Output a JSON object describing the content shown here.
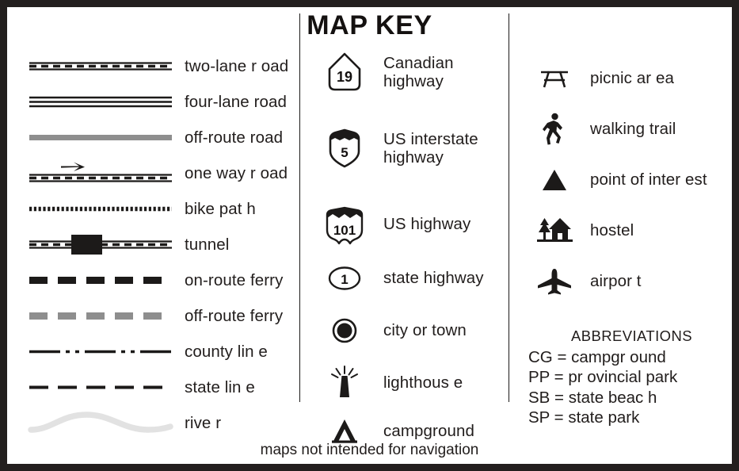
{
  "title": "MAP KEY",
  "footer": "maps not intended for navigation",
  "colors": {
    "ink": "#1c1a19",
    "frame": "#231f1e",
    "gray": "#8e8e8e",
    "river": "#e2e2e2",
    "paper": "#ffffff"
  },
  "columns": {
    "roads": {
      "name": "road-symbols",
      "items": [
        {
          "icon": "two-lane-road-symbol",
          "label": "two-lane r oad"
        },
        {
          "icon": "four-lane-road-symbol",
          "label": "four-lane road"
        },
        {
          "icon": "off-route-road-symbol",
          "label": "off-route road"
        },
        {
          "icon": "one-way-road-symbol",
          "label": "one way r oad"
        },
        {
          "icon": "bike-path-symbol",
          "label": "bike pat h"
        },
        {
          "icon": "tunnel-symbol",
          "label": "tunnel"
        },
        {
          "icon": "on-route-ferry-symbol",
          "label": "on-route ferry"
        },
        {
          "icon": "off-route-ferry-symbol",
          "label": "off-route ferry"
        },
        {
          "icon": "county-line-symbol",
          "label": "county lin e"
        },
        {
          "icon": "state-line-symbol",
          "label": "state lin e"
        },
        {
          "icon": "river-symbol",
          "label": "rive r"
        }
      ]
    },
    "routes": {
      "name": "route-marker-symbols",
      "items": [
        {
          "icon": "canadian-highway-shield-icon",
          "number": "19",
          "label": "Canadian\nhighway"
        },
        {
          "icon": "us-interstate-shield-icon",
          "number": "5",
          "label": "US interstate\nhighway"
        },
        {
          "icon": "us-highway-shield-icon",
          "number": "101",
          "label": "US highway"
        },
        {
          "icon": "state-highway-oval-icon",
          "number": "1",
          "label": "state highway"
        },
        {
          "icon": "city-or-town-icon",
          "number": "",
          "label": "city or town"
        },
        {
          "icon": "lighthouse-icon",
          "number": "",
          "label": "lighthous e"
        },
        {
          "icon": "campground-tent-icon",
          "number": "",
          "label": "campground"
        }
      ]
    },
    "points": {
      "name": "point-of-interest-symbols",
      "items": [
        {
          "icon": "picnic-table-icon",
          "label": "picnic ar ea"
        },
        {
          "icon": "walking-person-icon",
          "label": "walking trail"
        },
        {
          "icon": "triangle-marker-icon",
          "label": "point of inter est"
        },
        {
          "icon": "hostel-house-icon",
          "label": "hostel"
        },
        {
          "icon": "airplane-icon",
          "label": "airpor t"
        }
      ]
    }
  },
  "abbreviations": {
    "title": "ABBREVIATIONS",
    "entries": [
      "CG = campgr ound",
      "PP = pr ovincial park",
      "SB = state beac h",
      "SP = state park"
    ]
  }
}
